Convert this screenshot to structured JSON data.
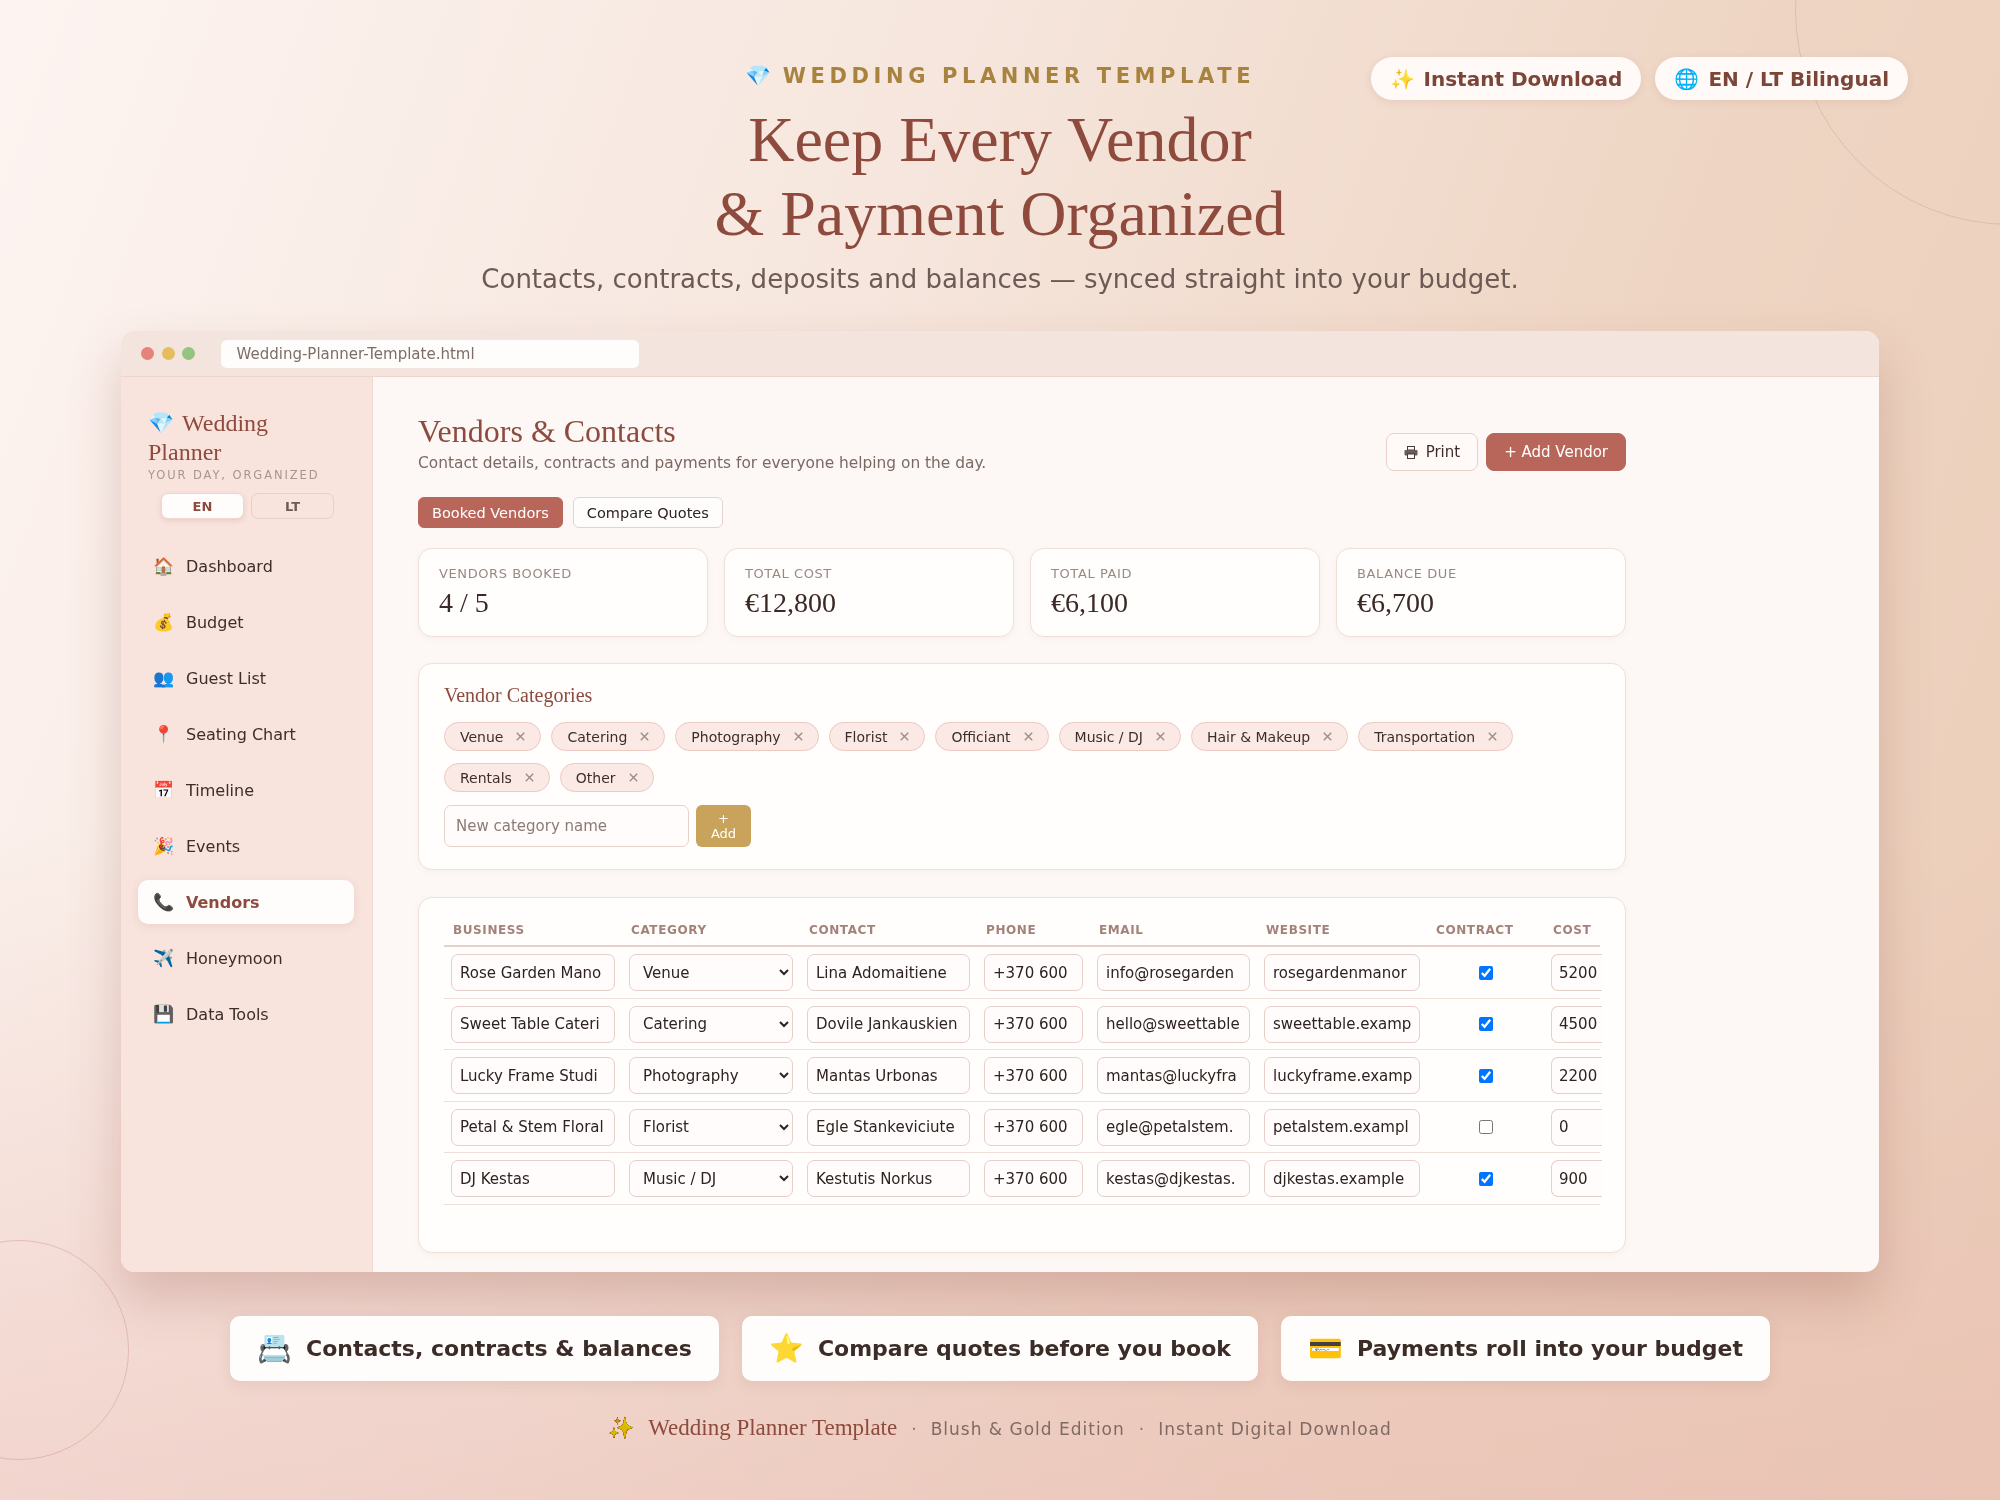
{
  "header": {
    "eyebrow_icon": "💎",
    "eyebrow": "WEDDING PLANNER TEMPLATE",
    "title_lines": [
      "Keep Every Vendor",
      "& Payment Organized"
    ],
    "subtitle": "Contacts, contracts, deposits and balances — synced straight into your budget.",
    "badges": [
      {
        "icon": "✨",
        "label": "Instant Download"
      },
      {
        "icon": "🌐",
        "label": "EN / LT Bilingual"
      }
    ]
  },
  "window": {
    "address": "Wedding-Planner-Template.html"
  },
  "sidebar": {
    "logo_icon": "💎",
    "logo_lines": [
      "Wedding",
      "Planner"
    ],
    "tagline": "YOUR DAY, ORGANIZED",
    "languages": [
      {
        "label": "EN",
        "selected": true
      },
      {
        "label": "LT",
        "selected": false
      }
    ],
    "items": [
      {
        "icon": "🏠",
        "label": "Dashboard",
        "selected": false
      },
      {
        "icon": "💰",
        "label": "Budget",
        "selected": false
      },
      {
        "icon": "👥",
        "label": "Guest List",
        "selected": false
      },
      {
        "icon": "📍",
        "label": "Seating Chart",
        "selected": false
      },
      {
        "icon": "📅",
        "label": "Timeline",
        "selected": false
      },
      {
        "icon": "🎉",
        "label": "Events",
        "selected": false
      },
      {
        "icon": "📞",
        "label": "Vendors",
        "selected": true
      },
      {
        "icon": "✈️",
        "label": "Honeymoon",
        "selected": false
      },
      {
        "icon": "💾",
        "label": "Data Tools",
        "selected": false
      }
    ]
  },
  "page": {
    "title": "Vendors & Contacts",
    "subtitle": "Contact details, contracts and payments for everyone helping on the day.",
    "actions": [
      {
        "kind": "print",
        "label": "Print"
      },
      {
        "kind": "primary",
        "label": "+ Add Vendor"
      }
    ],
    "tabs": [
      {
        "label": "Booked Vendors",
        "selected": true
      },
      {
        "label": "Compare Quotes",
        "selected": false
      }
    ],
    "stats": [
      {
        "label": "VENDORS BOOKED",
        "value": "4 / 5"
      },
      {
        "label": "TOTAL COST",
        "value": "€12,800"
      },
      {
        "label": "TOTAL PAID",
        "value": "€6,100"
      },
      {
        "label": "BALANCE DUE",
        "value": "€6,700"
      }
    ]
  },
  "categories": {
    "title": "Vendor Categories",
    "tags": [
      "Venue",
      "Catering",
      "Photography",
      "Florist",
      "Officiant",
      "Music / DJ",
      "Hair & Makeup",
      "Transportation",
      "Rentals",
      "Other"
    ],
    "new_category": {
      "placeholder": "New category name"
    },
    "add_button": "+ Add"
  },
  "table": {
    "columns": [
      "BUSINESS",
      "CATEGORY",
      "CONTACT",
      "PHONE",
      "EMAIL",
      "WEBSITE",
      "CONTRACT",
      "COST"
    ],
    "rows": [
      {
        "business": "Rose Garden Mano",
        "category": "Venue",
        "contact": "Lina Adomaitiene",
        "phone": "+370 600",
        "email": "info@rosegarden",
        "website": "rosegardenmanor",
        "contract": true,
        "cost": "5200"
      },
      {
        "business": "Sweet Table Cateri",
        "category": "Catering",
        "contact": "Dovile Jankauskien",
        "phone": "+370 600",
        "email": "hello@sweettable",
        "website": "sweettable.examp",
        "contract": true,
        "cost": "4500"
      },
      {
        "business": "Lucky Frame Studi",
        "category": "Photography",
        "contact": "Mantas Urbonas",
        "phone": "+370 600",
        "email": "mantas@luckyfra",
        "website": "luckyframe.examp",
        "contract": true,
        "cost": "2200"
      },
      {
        "business": "Petal & Stem Floral",
        "category": "Florist",
        "contact": "Egle Stankeviciute",
        "phone": "+370 600",
        "email": "egle@petalstem.",
        "website": "petalstem.exampl",
        "contract": false,
        "cost": "0"
      },
      {
        "business": "DJ Kestas",
        "category": "Music / DJ",
        "contact": "Kestutis Norkus",
        "phone": "+370 600",
        "email": "kestas@djkestas.",
        "website": "djkestas.example",
        "contract": true,
        "cost": "900"
      }
    ]
  },
  "features": [
    {
      "icon": "📇",
      "label": "Contacts, contracts & balances"
    },
    {
      "icon": "⭐",
      "label": "Compare quotes before you book"
    },
    {
      "icon": "💳",
      "label": "Payments roll into your budget"
    }
  ],
  "footer": {
    "icon": "✨",
    "brand": "Wedding Planner Template",
    "items": [
      {
        "separator": "·",
        "label": "Blush & Gold Edition"
      },
      {
        "separator": "·",
        "label": "Instant Digital Download"
      }
    ]
  }
}
